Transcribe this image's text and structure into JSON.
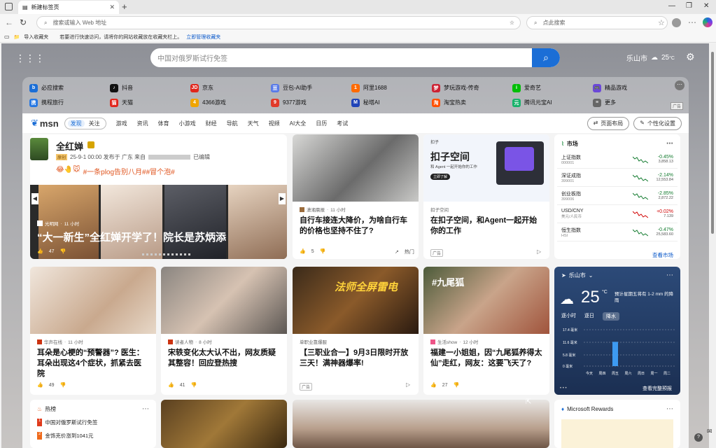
{
  "browser": {
    "tab_title": "新建标签页",
    "url_placeholder": "搜索或输入 Web 地址",
    "side_search": "点此搜索",
    "fav_import": "导入收藏夹",
    "fav_hint": "若要进行快速访问，请将你的网站收藏放在收藏夹栏上。",
    "fav_manage": "立即管理收藏夹"
  },
  "msn_search": {
    "placeholder": "中国对俄罗斯试行免签"
  },
  "weather_top": {
    "city": "乐山市",
    "temp": "25",
    "unit": "°C"
  },
  "quick_links": [
    {
      "label": "必应搜索",
      "color": "#1b6ed6",
      "g": "b"
    },
    {
      "label": "抖音",
      "color": "#111",
      "g": "♪"
    },
    {
      "label": "京东",
      "color": "#e1251b",
      "g": "JD"
    },
    {
      "label": "豆包-AI助手",
      "color": "#5a7be8",
      "g": "豆"
    },
    {
      "label": "阿里1688",
      "color": "#ff6a00",
      "g": "1"
    },
    {
      "label": "梦玩游戏-传奇",
      "color": "#c23",
      "g": "梦"
    },
    {
      "label": "爱奇艺",
      "color": "#00be06",
      "g": "i"
    },
    {
      "label": "精品游戏",
      "color": "#6b48d8",
      "g": "🎮"
    },
    {
      "label": "携程旅行",
      "color": "#2577e3",
      "g": "携"
    },
    {
      "label": "天猫",
      "color": "#e1251b",
      "g": "猫"
    },
    {
      "label": "4366游戏",
      "color": "#f0a500",
      "g": "4"
    },
    {
      "label": "9377游戏",
      "color": "#e13a2a",
      "g": "9"
    },
    {
      "label": "秘塔AI",
      "color": "#2044b8",
      "g": "M"
    },
    {
      "label": "淘宝热卖",
      "color": "#ff5000",
      "g": "淘"
    },
    {
      "label": "腾讯元宝AI",
      "color": "#17b26a",
      "g": "元"
    },
    {
      "label": "更多",
      "color": "#666",
      "g": "≡"
    }
  ],
  "feed_nav": {
    "logo": "msn",
    "tabs": [
      "发现",
      "关注",
      "游戏",
      "资讯",
      "体育",
      "小游戏",
      "财经",
      "导航",
      "天气",
      "视频",
      "AI大全",
      "日历",
      "考试"
    ],
    "layout_btn": "页面布局",
    "personal_btn": "个性化设置"
  },
  "hero": {
    "name": "全红婵",
    "tag": "原创",
    "meta": "25-9-1 00:00 发布于 广东 来自",
    "source_tail": "已编辑",
    "hashtags": "#一条plog告别八月##冒个泡#",
    "src": "光明网",
    "time": "11 小时",
    "title": "“大一新生”全红婵开学了！院长是苏炳添",
    "likes": "47"
  },
  "cards": [
    {
      "src": "潇湘晨报",
      "time": "11 小时",
      "title": "自行车接连大降价，为啥自行车的价格也坚持不住了?",
      "likes": "5",
      "tag": "热门"
    },
    {
      "src": "扣子空间",
      "title": "在扣子空间，和Agent一起开始你的工作",
      "ad": "广告",
      "banner_title": "扣子空间",
      "banner_sub": "和 Agent 一起开始你的工作",
      "banner_btn": "立即了解",
      "banner_brand": "扣子"
    },
    {
      "src": "华声在线",
      "time": "11 小时",
      "title": "耳朵是心梗的“预警器”? 医生：耳朵出现这4个症状，抓紧去医院",
      "likes": "49"
    },
    {
      "src": "读者人物",
      "time": "8 小时",
      "title": "宋轶变化太大认不出，网友质疑其整容！回应登热搜",
      "likes": "41"
    },
    {
      "src": "单职业靠爆服",
      "title": "【三职业合一】9月3日限时开放三天！满神器爆率!",
      "ad": "广告",
      "img_text": "法师全屏雷电"
    },
    {
      "src": "生活show",
      "time": "12 小时",
      "title": "福建一小姐姐，因“九尾狐养得太仙”走红，网友：这要飞天了?",
      "likes": "27",
      "img_text": "#九尾狐"
    }
  ],
  "market": {
    "title": "市场",
    "more": "查看市场",
    "rows": [
      {
        "name": "上证指数",
        "code": "000001",
        "chg": "-0.45%",
        "val": "3,858.13",
        "dir": "pos"
      },
      {
        "name": "深证成指",
        "code": "399001",
        "chg": "-2.14%",
        "val": "12,553.84",
        "dir": "pos"
      },
      {
        "name": "创业板指",
        "code": "399006",
        "chg": "-2.85%",
        "val": "2,872.22",
        "dir": "pos"
      },
      {
        "name": "USD/CNY",
        "code": "美元/人民币",
        "chg": "+0.02%",
        "val": "7.139",
        "dir": "neg"
      },
      {
        "name": "恒生指数",
        "code": "HSI",
        "chg": "-0.47%",
        "val": "25,583.60",
        "dir": "pos"
      }
    ]
  },
  "weather": {
    "city": "乐山市",
    "temp": "25",
    "unit": "°C",
    "desc": "预计星期五将有 1-2 mm 的降雨",
    "tabs": [
      "逐小时",
      "逐日",
      "降水"
    ],
    "ylabels": [
      "17.4 毫米",
      "11.6 毫米",
      "5.8 毫米",
      "0 毫米"
    ],
    "xlabels": [
      "今天",
      "周四",
      "周五",
      "周六",
      "周日",
      "周一",
      "周二"
    ],
    "precip_mm": [
      0,
      0,
      11.6,
      0,
      0,
      0,
      0
    ],
    "more": "查看完整预报"
  },
  "bottom": {
    "hot_title": "热榜",
    "hot": [
      "中国对俄罗斯试行免签",
      "金饰克价涨到1041元"
    ],
    "rewards_title": "Microsoft Rewards"
  }
}
